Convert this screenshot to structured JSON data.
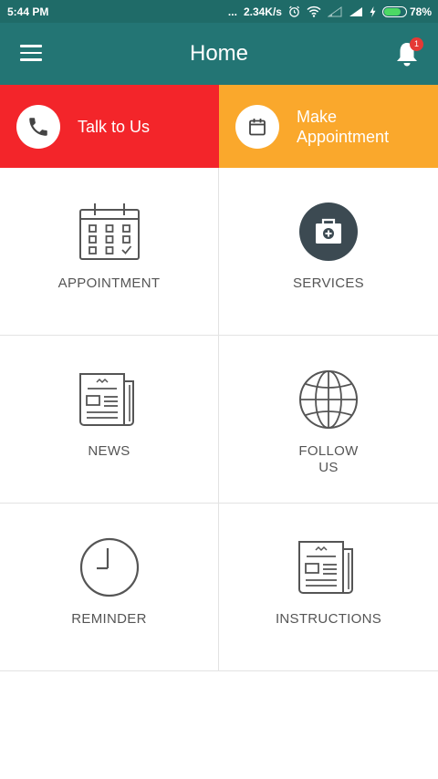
{
  "statusbar": {
    "time": "5:44 PM",
    "dots": "...",
    "speed": "2.34K/s",
    "battery": "78%",
    "battery_level": 0.78
  },
  "appbar": {
    "title": "Home",
    "notification_count": "1"
  },
  "quick_actions": [
    {
      "label": "Talk to Us",
      "icon": "phone-icon",
      "color": "#f3252a"
    },
    {
      "label": "Make Appointment",
      "icon": "calendar-icon",
      "color": "#faa82c"
    }
  ],
  "grid": {
    "appointment": "APPOINTMENT",
    "services": "SERVICES",
    "news": "NEWS",
    "follow_us": "FOLLOW US",
    "reminder": "REMINDER",
    "instructions": "INSTRUCTIONS"
  },
  "colors": {
    "appbar": "#237574",
    "statusbar": "#1f6b68",
    "icon_stroke": "#555555"
  }
}
